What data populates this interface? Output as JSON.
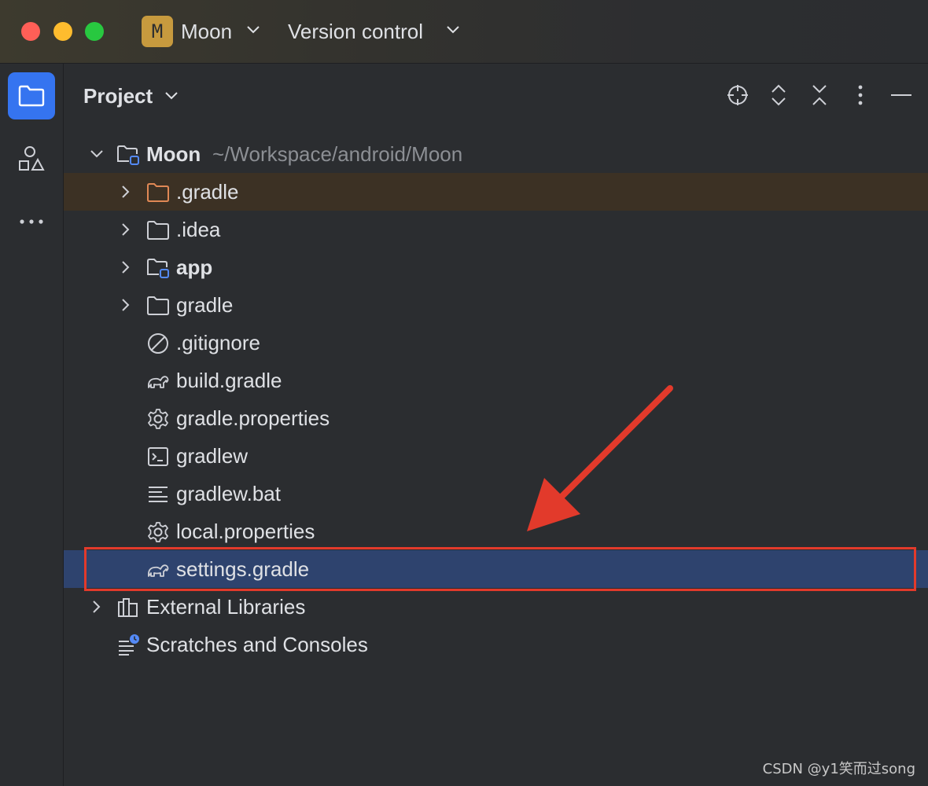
{
  "titlebar": {
    "project_badge": "M",
    "project_name": "Moon",
    "vcs_label": "Version control"
  },
  "sidebar": {
    "items": [
      {
        "name": "project-tool",
        "icon": "folder-icon",
        "active": true
      },
      {
        "name": "structure-tool",
        "icon": "structure-icon"
      },
      {
        "name": "more-tools",
        "icon": "more-horizontal-icon"
      }
    ]
  },
  "panel": {
    "title": "Project",
    "toolbar": [
      "locate-icon",
      "expand-all-icon",
      "collapse-all-icon",
      "options-icon",
      "hide-icon"
    ]
  },
  "tree": {
    "root": {
      "label": "Moon",
      "path": "~/Workspace/android/Moon"
    },
    "children": [
      {
        "label": ".gradle",
        "icon": "folder-orange-icon"
      },
      {
        "label": ".idea",
        "icon": "folder-icon"
      },
      {
        "label": "app",
        "icon": "module-folder-icon"
      },
      {
        "label": "gradle",
        "icon": "folder-icon"
      },
      {
        "label": ".gitignore",
        "icon": "ignore-file-icon"
      },
      {
        "label": "build.gradle",
        "icon": "gradle-elephant-icon"
      },
      {
        "label": "gradle.properties",
        "icon": "gear-icon"
      },
      {
        "label": "gradlew",
        "icon": "terminal-icon"
      },
      {
        "label": "gradlew.bat",
        "icon": "text-file-icon"
      },
      {
        "label": "local.properties",
        "icon": "gear-icon"
      },
      {
        "label": "settings.gradle",
        "icon": "gradle-elephant-icon",
        "selected": true
      }
    ],
    "external_libraries": "External Libraries",
    "scratches": "Scratches and Consoles"
  },
  "colors": {
    "selection": "#2e436e",
    "highlight": "#3c3124",
    "annotation": "#e23a2b",
    "accent": "#3574f0"
  },
  "watermark": "CSDN @y1笑而过song"
}
